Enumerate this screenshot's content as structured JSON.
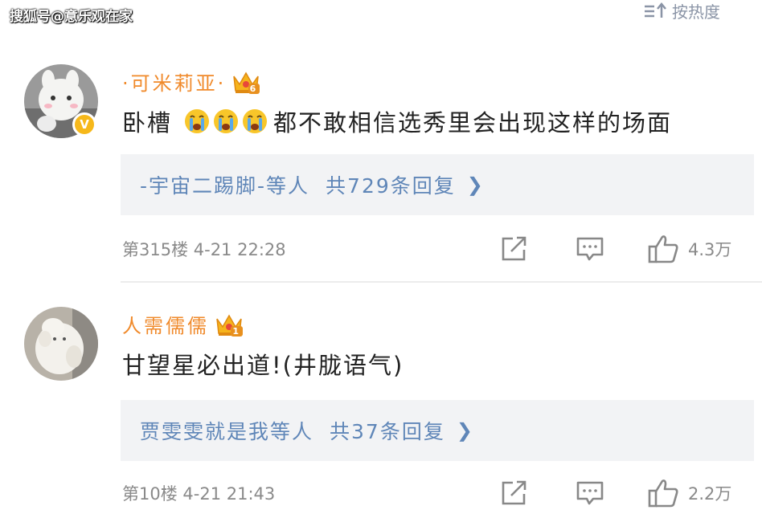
{
  "watermark": "搜狐号@意乐观在家",
  "sort": {
    "label": "按热度"
  },
  "comments": [
    {
      "username": "·可米莉亚·",
      "level": "6",
      "text_before": "卧槽",
      "emoji_count": 3,
      "emoji": "crying-emoji",
      "text_after": "都不敢相信选秀里会出现这样的场面",
      "reply_users": "-宇宙二踢脚-等人",
      "reply_count": "共729条回复",
      "floor_time": "第315楼 4-21 22:28",
      "likes": "4.3万",
      "verified": true
    },
    {
      "username": "人需儒儒",
      "level": "1",
      "text": "甘望星必出道!(井胧语气)",
      "reply_users": "贾雯雯就是我等人",
      "reply_count": "共37条回复",
      "floor_time": "第10楼 4-21 21:43",
      "likes": "2.2万",
      "verified": false
    }
  ],
  "colors": {
    "username": "#f08a2b",
    "reply_link": "#5f86b8",
    "reply_bg": "#f2f3f5",
    "meta": "#8a8a8a",
    "icon": "#888888"
  }
}
